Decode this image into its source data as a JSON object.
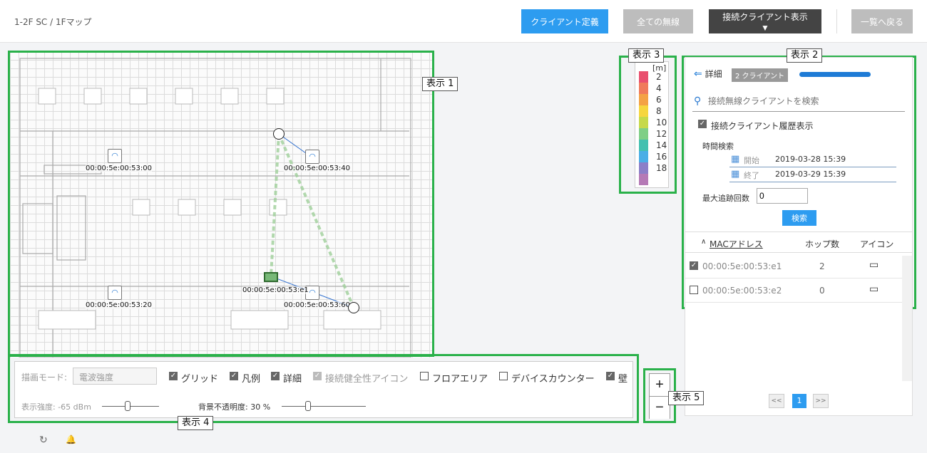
{
  "breadcrumb": "1-2F SC  /  1Fマップ",
  "header": {
    "client_def": "クライアント定義",
    "all_unwired": "全ての無線",
    "show_clients": "接続クライアント表示 ▼",
    "back": "一覧へ戻る"
  },
  "map": {
    "aps": [
      {
        "label": "00:00:5e:00:53:00"
      },
      {
        "label": "00:00:5e:00:53:40"
      },
      {
        "label": "00:00:5e:00:53:20"
      },
      {
        "label": "00:00:5e:00:53:60"
      }
    ],
    "client_label": "00:00:5e:00:53:e1",
    "wifi_glyph": "◠"
  },
  "tags": {
    "t1": "表示 1",
    "t2": "表示 2",
    "t3": "表示 3",
    "t4": "表示 4",
    "t5": "表示 5"
  },
  "legend": {
    "unit": "[m]",
    "items": [
      {
        "value": "2",
        "color": "#e94f6e"
      },
      {
        "value": "4",
        "color": "#f07a5a"
      },
      {
        "value": "6",
        "color": "#f4a244"
      },
      {
        "value": "8",
        "color": "#f6d63e"
      },
      {
        "value": "10",
        "color": "#c6d94a"
      },
      {
        "value": "12",
        "color": "#7fcf86"
      },
      {
        "value": "14",
        "color": "#42c0b0"
      },
      {
        "value": "16",
        "color": "#4aaee6"
      },
      {
        "value": "18",
        "color": "#8b7fc8"
      },
      {
        "value": "",
        "color": "#b57ab6"
      }
    ]
  },
  "panel": {
    "back_icon": "⇐",
    "title": "詳細",
    "badge": "2 クライアント",
    "search_placeholder": "接続無線クライアントを検索",
    "search_icon": "⚲",
    "history_label": "接続クライアント履歴表示",
    "time_search": "時間検索",
    "start_label": "開始",
    "start_value": "2019-03-28 15:39",
    "end_label": "終了",
    "end_value": "2019-03-29 15:39",
    "calendar_icon": "▦",
    "max_trace_label": "最大追跡回数",
    "max_trace_value": "0",
    "search_button": "検索",
    "sort_icon": "∧",
    "col_mac": "MACアドレス",
    "col_hops": "ホップ数",
    "col_icon": "アイコン",
    "rows": [
      {
        "mac": "00:00:5e:00:53:e1",
        "hops": "2",
        "checked": true
      },
      {
        "mac": "00:00:5e:00:53:e2",
        "hops": "0",
        "checked": false
      }
    ],
    "laptop_glyph": "▭",
    "pager_prev": "<<",
    "pager_page": "1",
    "pager_next": ">>"
  },
  "toolbar": {
    "mode_label": "描画モード:",
    "mode_value": "電波強度",
    "grid": "グリッド",
    "legend": "凡例",
    "detail": "詳細",
    "health": "接続健全性アイコン",
    "floor_area": "フロアエリア",
    "device_counter": "デバイスカウンター",
    "wall": "壁",
    "strength_label": "表示強度: -65 dBm",
    "strength_percent": 44,
    "opacity_label": "背景不透明度: 30 %",
    "opacity_percent": 30,
    "check_glyph": "✓"
  },
  "zoom": {
    "in": "+",
    "out": "−"
  },
  "footer": {
    "refresh": "↻",
    "bell": "🔔"
  }
}
